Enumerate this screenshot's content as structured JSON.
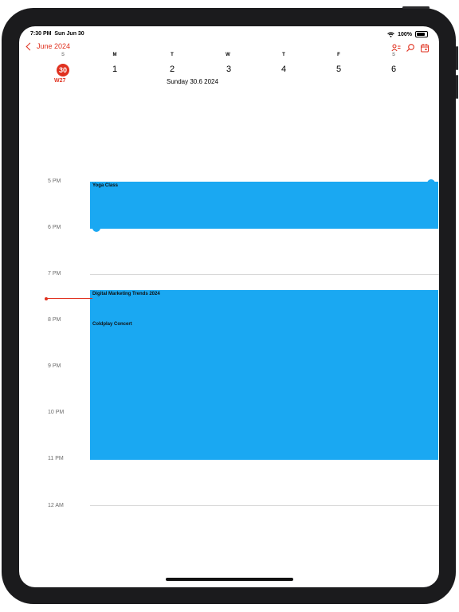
{
  "status_bar": {
    "time": "7:30 PM",
    "date": "Sun Jun 30",
    "battery": "100%"
  },
  "nav": {
    "back_label": "June 2024"
  },
  "week": {
    "days": [
      {
        "letter": "S",
        "number": "30"
      },
      {
        "letter": "M",
        "number": "1"
      },
      {
        "letter": "T",
        "number": "2"
      },
      {
        "letter": "W",
        "number": "3"
      },
      {
        "letter": "T",
        "number": "4"
      },
      {
        "letter": "F",
        "number": "5"
      },
      {
        "letter": "S",
        "number": "6"
      }
    ],
    "week_number": "W27",
    "selected_date_caption": "Sunday 30.6 2024"
  },
  "timeline": {
    "hours": [
      "5 PM",
      "6 PM",
      "7 PM",
      "8 PM",
      "9 PM",
      "10 PM",
      "11 PM",
      "12 AM"
    ]
  },
  "events": [
    {
      "title": "Yoga Class",
      "color": "#1aa8f2"
    },
    {
      "title": "Digital Marketing Trends 2024",
      "color": "#1aa8f2"
    },
    {
      "title": "Coldplay Concert",
      "color": "#1aa8f2"
    }
  ],
  "colors": {
    "accent": "#e0311f",
    "event": "#1aa8f2"
  },
  "icons": [
    "chevron-left-icon",
    "people-icon",
    "search-icon",
    "calendar-icon",
    "wifi-icon",
    "battery-icon"
  ]
}
